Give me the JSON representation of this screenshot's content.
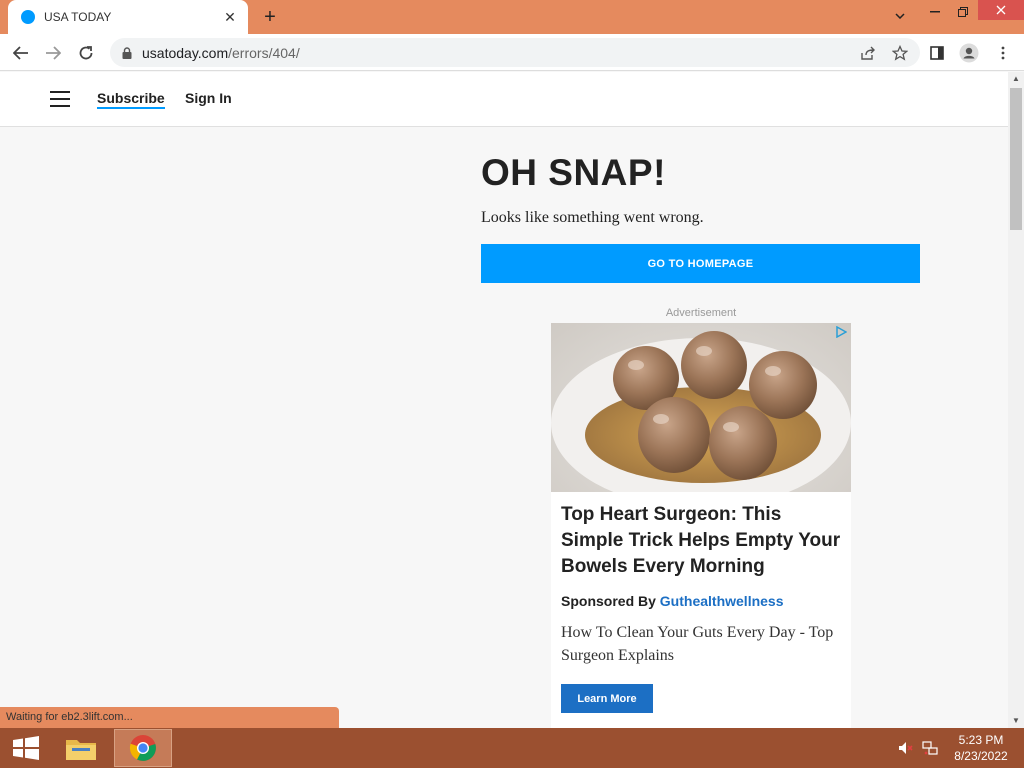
{
  "browser": {
    "tab_title": "USA TODAY",
    "url_host": "usatoday.com",
    "url_path": "/errors/404/",
    "status_text": "Waiting for eb2.3lift.com..."
  },
  "site": {
    "subscribe_label": "Subscribe",
    "signin_label": "Sign In"
  },
  "error": {
    "title": "OH SNAP!",
    "message": "Looks like something went wrong.",
    "home_button": "GO TO HOMEPAGE"
  },
  "ad": {
    "label": "Advertisement",
    "headline": "Top Heart Surgeon: This Simple Trick Helps Empty Your Bowels Every Morning",
    "sponsored_by": "Sponsored By",
    "sponsor_name": "Guthealthwellness",
    "description": "How To Clean Your Guts Every Day - Top Surgeon Explains",
    "cta": "Learn More"
  },
  "taskbar": {
    "time": "5:23 PM",
    "date": "8/23/2022"
  },
  "colors": {
    "accent": "#009bff",
    "ad_blue": "#1c6fc4",
    "chrome_frame": "#e58a5e",
    "taskbar": "#9b5030"
  }
}
